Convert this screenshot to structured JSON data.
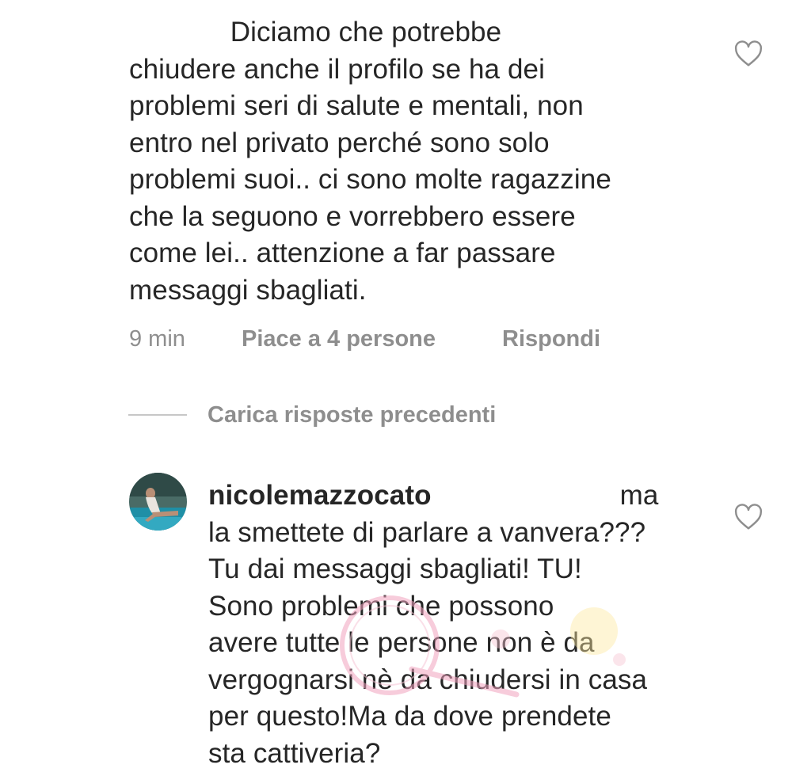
{
  "comment1": {
    "lines": [
      "             Diciamo che potrebbe",
      "chiudere anche il profilo se ha dei",
      "problemi seri di salute e mentali, non",
      "entro nel privato perché sono solo",
      "problemi suoi.. ci sono molte ragazzine",
      "che la seguono e vorrebbero essere",
      "come lei.. attenzione a far passare",
      "messaggi sbagliati."
    ],
    "time": "9 min",
    "likes": "Piace a 4 persone",
    "reply": "Rispondi",
    "like_icon": "heart-outline-icon"
  },
  "load_replies": {
    "label": "Carica risposte precedenti"
  },
  "comment2": {
    "username": "nicolemazzocato",
    "first_line_rest": "ma",
    "lines": [
      "la smettete di parlare a vanvera???",
      "Tu dai messaggi sbagliati! TU!",
      "Sono problemi che possono",
      "avere tutte le persone non è da",
      "vergognarsi nè da chiudersi in casa",
      "per questo!Ma da dove prendete",
      "sta cattiveria?"
    ],
    "like_icon": "heart-outline-icon",
    "avatar_icon": "profile-photo-avatar"
  },
  "colors": {
    "text": "#262626",
    "secondary": "#8e8e8e",
    "divider": "#c7c7c7",
    "background": "#ffffff"
  }
}
